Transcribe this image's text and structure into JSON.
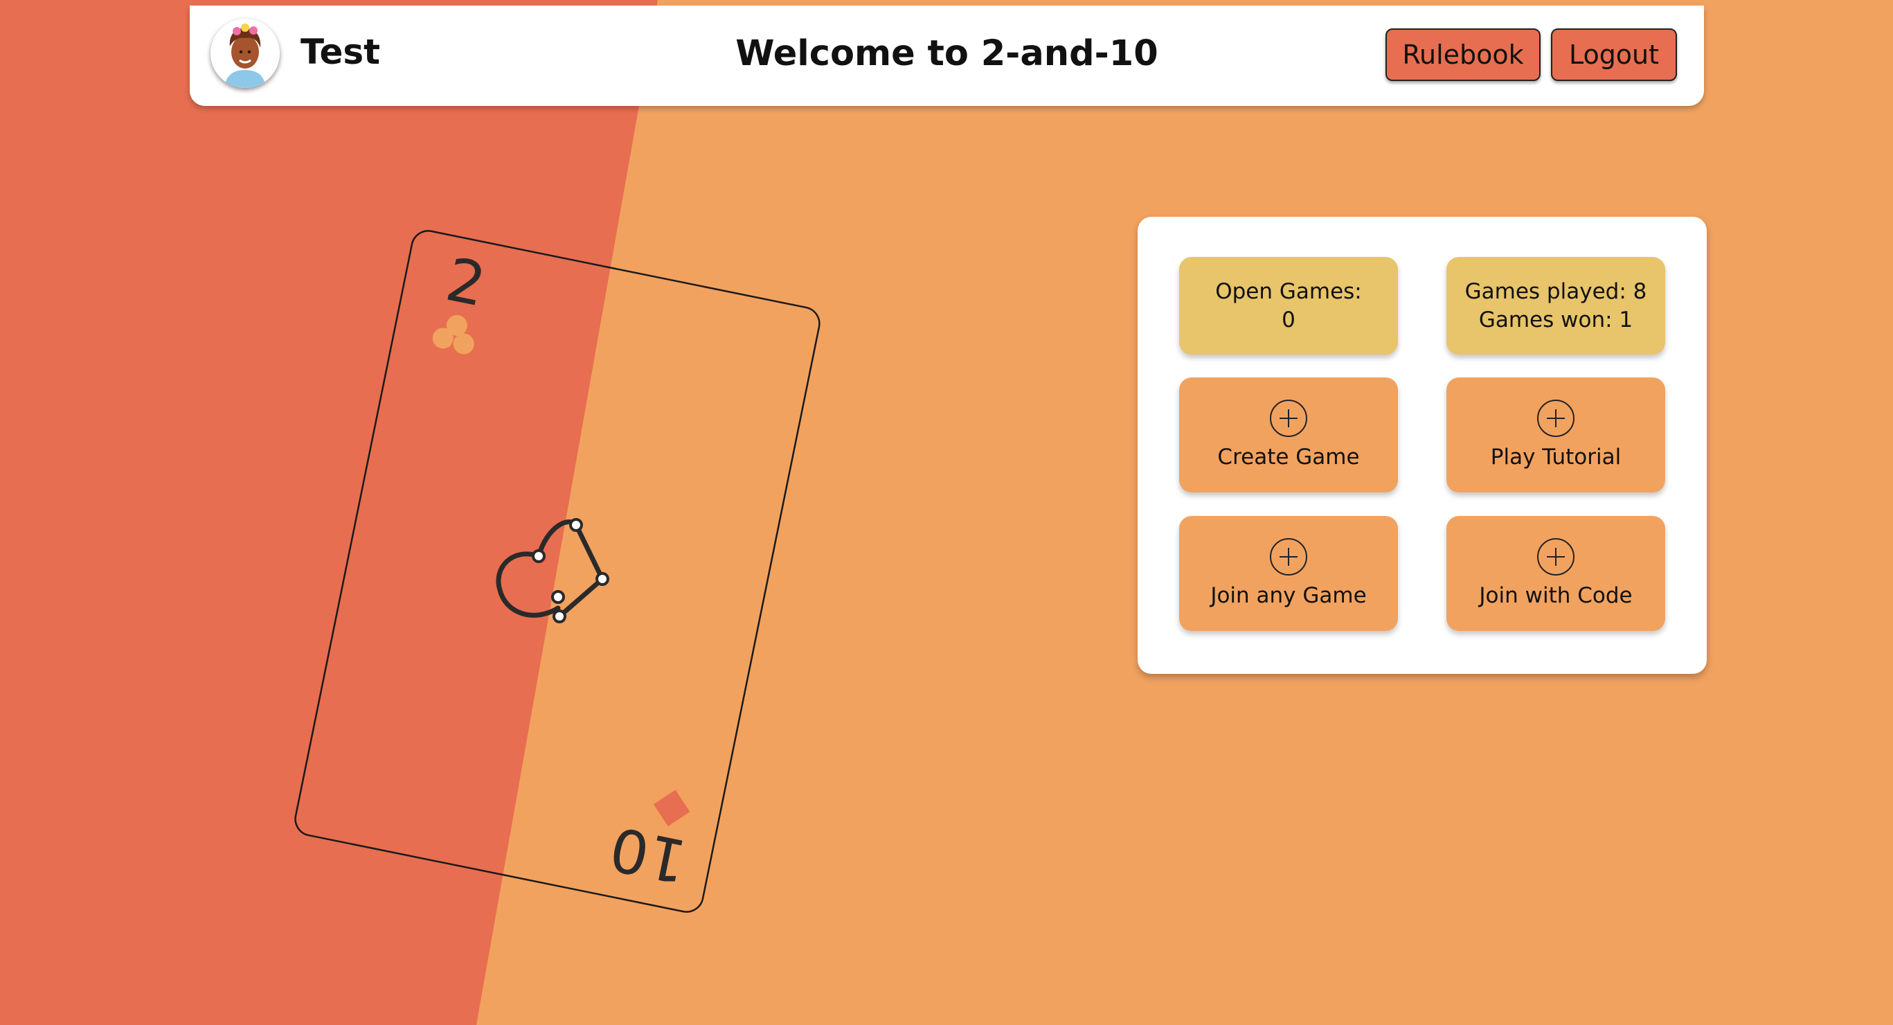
{
  "colors": {
    "background_light": "#F2A25F",
    "background_dark": "#E76E50",
    "info_tile": "#E8C46A",
    "action_tile": "#F2A25F",
    "button": "#E76E50",
    "text": "#111111"
  },
  "header": {
    "username": "Test",
    "title": "Welcome to 2-and-10",
    "rulebook_label": "Rulebook",
    "logout_label": "Logout"
  },
  "card": {
    "top_rank": "2",
    "top_suit_icon": "club-icon",
    "bottom_rank": "10",
    "bottom_suit_icon": "diamond-icon",
    "center_icon": "heart-outline-icon"
  },
  "panel": {
    "open_games_label": "Open Games:",
    "open_games_value": "0",
    "games_played": "Games played: 8",
    "games_won": "Games won: 1",
    "create_game": "Create Game",
    "play_tutorial": "Play Tutorial",
    "join_any_game": "Join any Game",
    "join_with_code": "Join with Code",
    "action_icon": "plus-circle-icon"
  }
}
